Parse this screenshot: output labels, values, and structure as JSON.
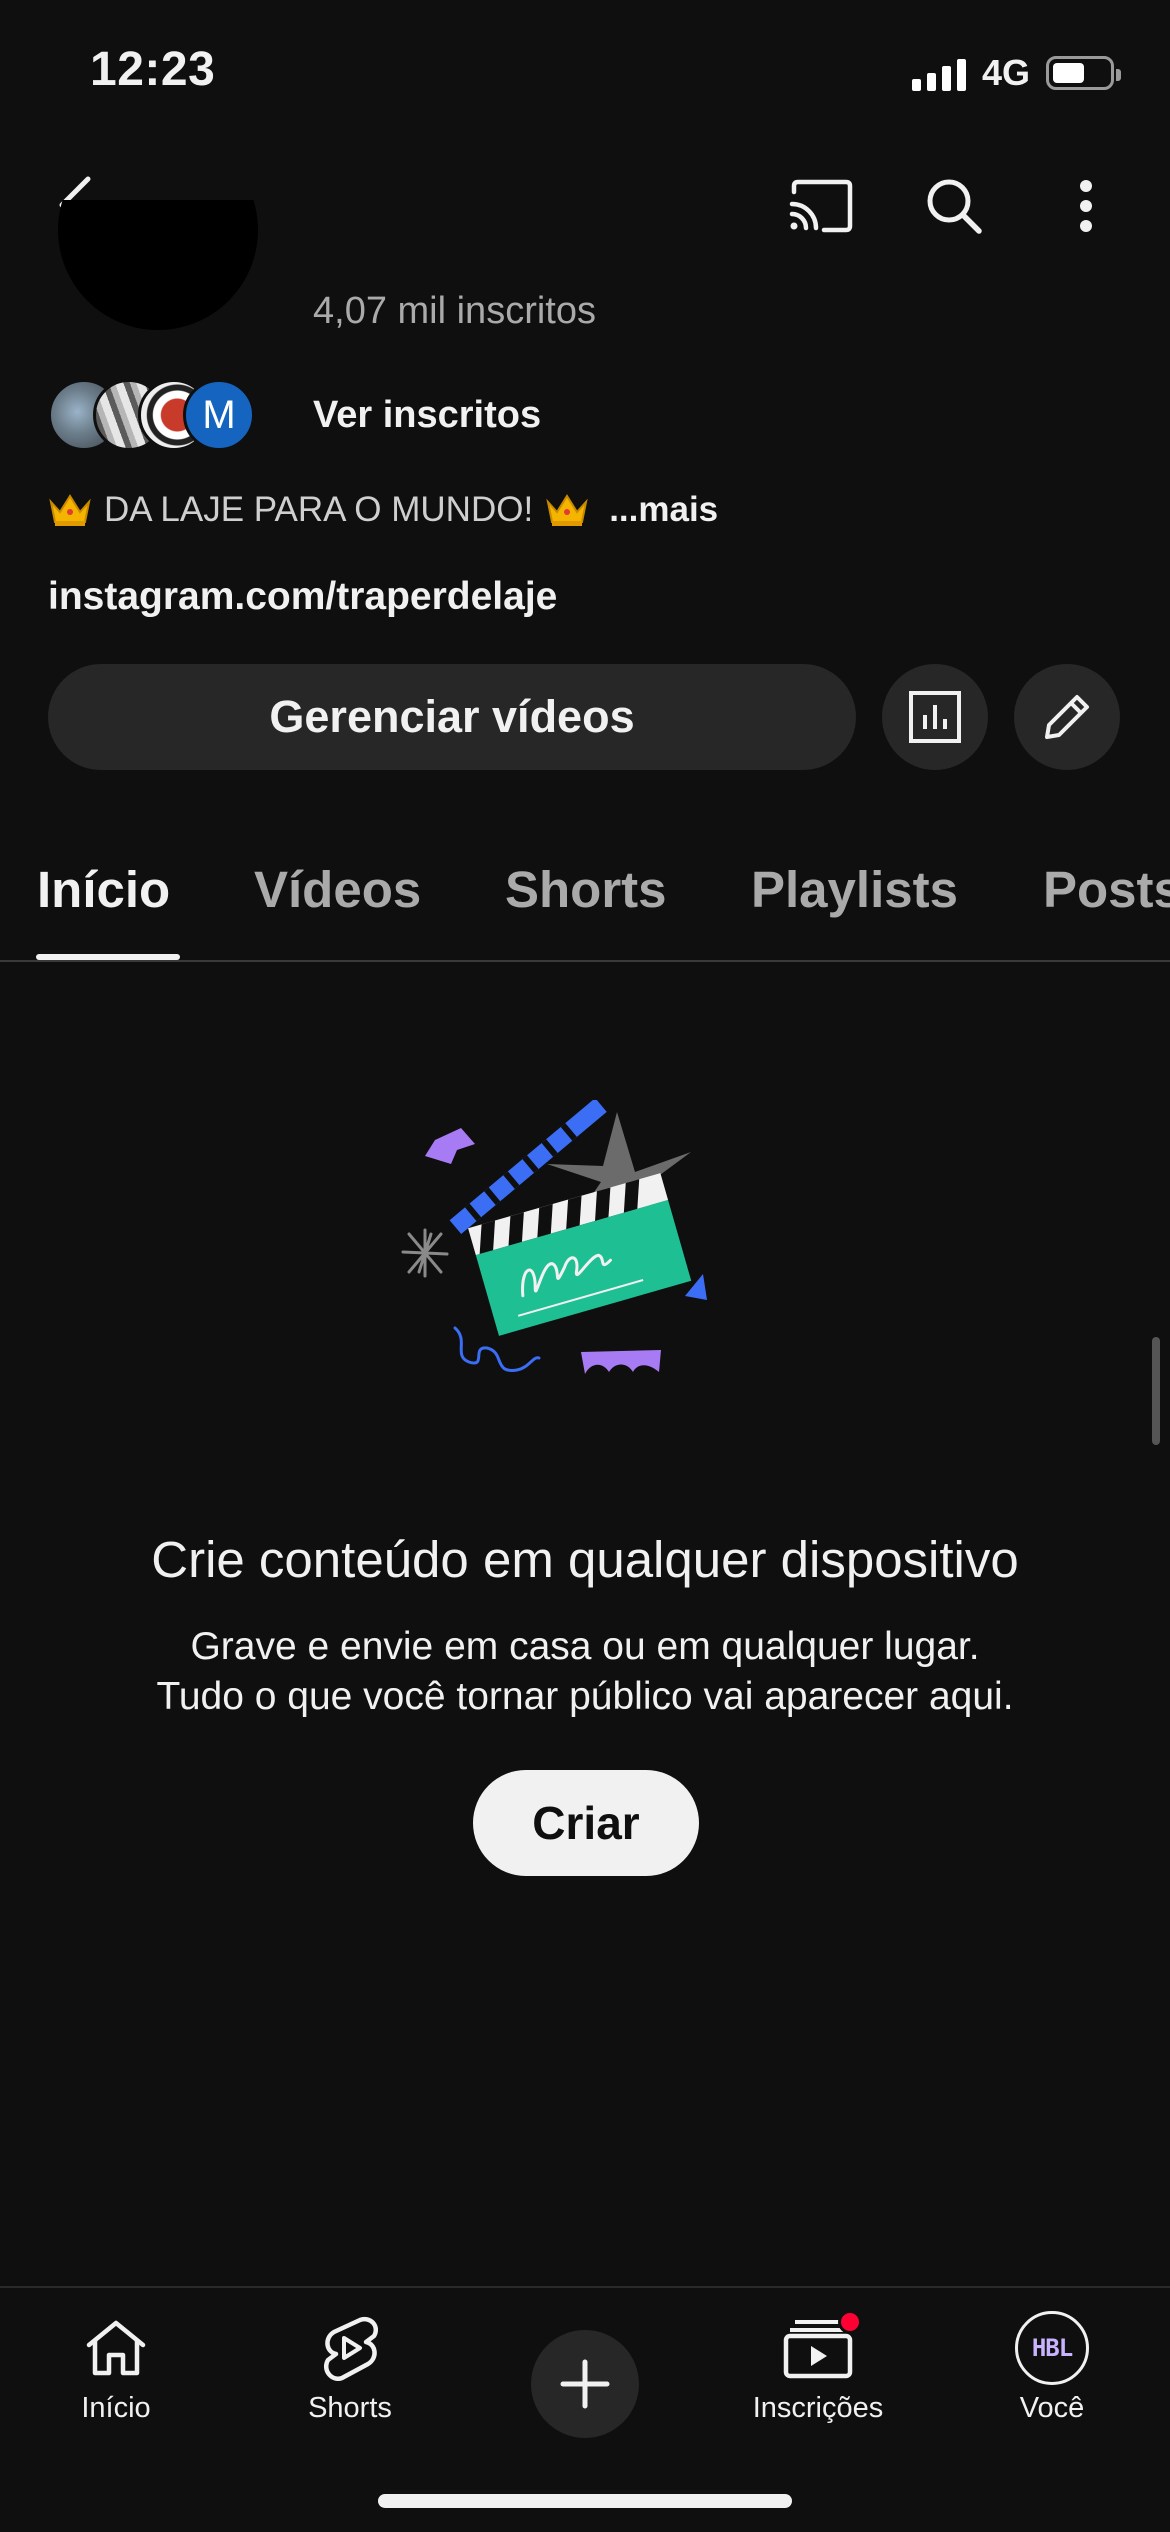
{
  "status_bar": {
    "time": "12:23",
    "network": "4G",
    "battery_level": 0.55
  },
  "channel": {
    "subscriber_count": "4,07 mil inscritos",
    "see_subscribers": "Ver inscritos",
    "subscriber_avatar_initial": "M",
    "bio": "DA LAJE PARA O MUNDO!",
    "bio_more": "...mais",
    "link": "instagram.com/traperdelaje",
    "manage_videos": "Gerenciar vídeos"
  },
  "tabs": [
    {
      "label": "Início",
      "active": true
    },
    {
      "label": "Vídeos",
      "active": false
    },
    {
      "label": "Shorts",
      "active": false
    },
    {
      "label": "Playlists",
      "active": false
    },
    {
      "label": "Posts",
      "active": false
    }
  ],
  "empty_state": {
    "title": "Crie conteúdo em qualquer dispositivo",
    "line1": "Grave e envie em casa ou em qualquer lugar.",
    "line2": "Tudo o que você tornar público vai aparecer aqui.",
    "button": "Criar"
  },
  "bottom_nav": {
    "home": "Início",
    "shorts": "Shorts",
    "subscriptions": "Inscrições",
    "you": "Você",
    "you_avatar_text": "HBL"
  },
  "colors": {
    "background": "#0f0f0f",
    "surface": "#272727",
    "notification": "#ff0033",
    "illustration_green": "#1fbf94",
    "illustration_blue": "#3b6ef5",
    "illustration_purple": "#a77bf3"
  }
}
